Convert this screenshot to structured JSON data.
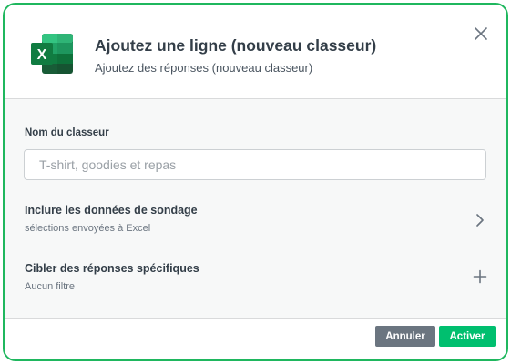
{
  "header": {
    "title": "Ajoutez une ligne (nouveau classeur)",
    "subtitle": "Ajoutez des réponses (nouveau classeur)",
    "app_icon": "excel-icon",
    "close_icon": "close-icon"
  },
  "form": {
    "name_label": "Nom du classeur",
    "name_placeholder": "T-shirt, goodies et repas",
    "name_value": ""
  },
  "options": [
    {
      "title": "Inclure les données de sondage",
      "subtitle": "sélections envoyées à Excel",
      "icon": "chevron-right-icon"
    },
    {
      "title": "Cibler des réponses spécifiques",
      "subtitle": "Aucun filtre",
      "icon": "plus-icon"
    }
  ],
  "footer": {
    "cancel_label": "Annuler",
    "activate_label": "Activer"
  },
  "colors": {
    "accent": "#00bf6f",
    "border": "#1fb75e",
    "cancel": "#6b7580",
    "excel": "#107c41"
  }
}
